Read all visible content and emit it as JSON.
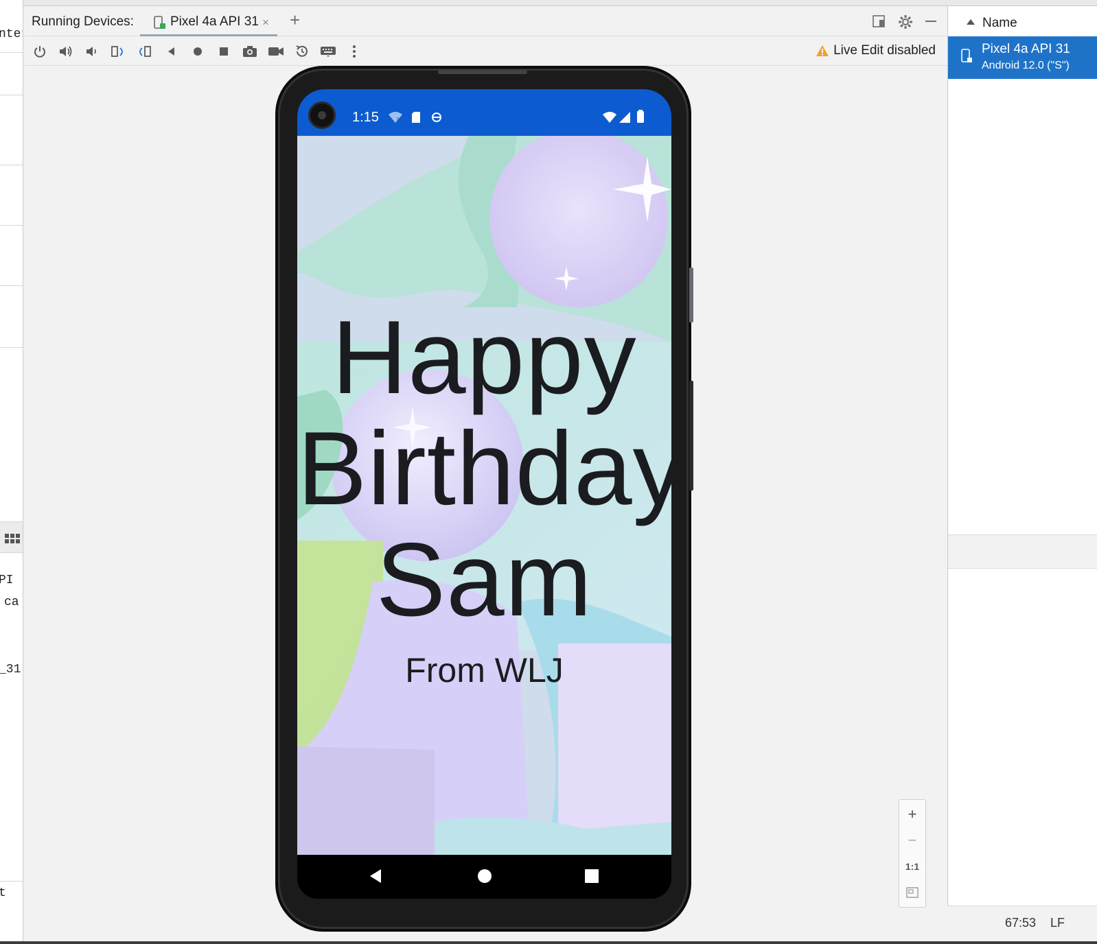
{
  "left_strip": {
    "fragments": [
      "nter",
      "PI",
      "ca",
      "_31",
      "t"
    ]
  },
  "panel": {
    "title": "Running Devices:",
    "tab_label": "Pixel 4a API 31",
    "tab_close": "×",
    "add_tab": "+",
    "live_edit": "Live Edit disabled",
    "toolbar_icons": [
      "power-icon",
      "volume-up-icon",
      "volume-down-icon",
      "rotate-left-icon",
      "rotate-right-icon",
      "back-icon",
      "home-icon",
      "overview-icon",
      "screenshot-icon",
      "screen-record-icon",
      "snapshot-icon",
      "keyboard-icon",
      "more-icon"
    ]
  },
  "phone": {
    "status_time": "1:15",
    "greeting": "Happy Birthday Sam",
    "signature": "From WLJ"
  },
  "zoom": {
    "zoom_in": "+",
    "zoom_out": "−",
    "actual_size": "1:1"
  },
  "devices_panel": {
    "column_header": "Name",
    "device_name": "Pixel 4a API 31",
    "device_version": "Android 12.0 (\"S\")"
  },
  "ide_status": {
    "position": "67:53",
    "line_ending": "LF"
  },
  "colors": {
    "accent": "#1e73c9",
    "status_bar": "#0d5bd0",
    "warning": "#f0a030"
  }
}
